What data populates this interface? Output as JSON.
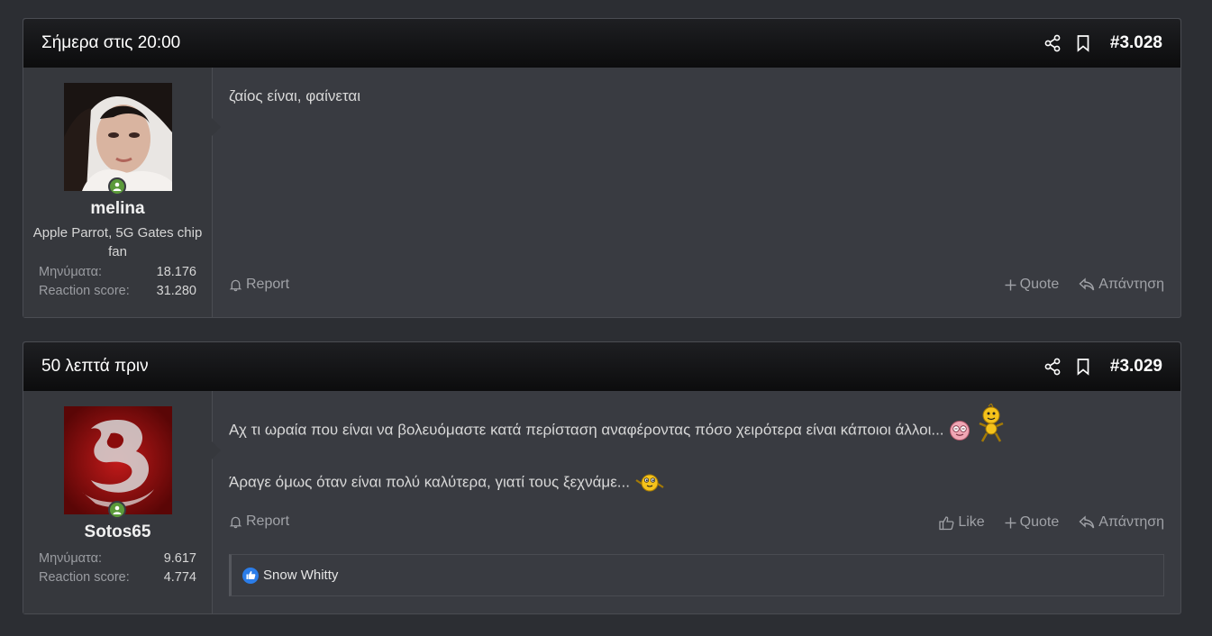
{
  "posts": [
    {
      "date": "Σήμερα στις 20:00",
      "number": "#3.028",
      "user": {
        "name": "melina",
        "title": "Apple Parrot, 5G Gates chip fan",
        "stats": [
          {
            "label": "Μηνύματα:",
            "value": "18.176"
          },
          {
            "label": "Reaction score:",
            "value": "31.280"
          }
        ]
      },
      "message": [
        "ζαίος είναι, φαίνεται"
      ],
      "actions": {
        "report": "Report",
        "quote": "Quote",
        "reply": "Απάντηση"
      }
    },
    {
      "date": "50 λεπτά πριν",
      "number": "#3.029",
      "user": {
        "name": "Sotos65",
        "stats": [
          {
            "label": "Μηνύματα:",
            "value": "9.617"
          },
          {
            "label": "Reaction score:",
            "value": "4.774"
          }
        ]
      },
      "message": [
        "Αχ τι ωραία που είναι να βολευόμαστε κατά περίσταση αναφέροντας πόσο χειρότερα είναι κάποιοι άλλοι...",
        "Άραγε όμως όταν είναι πολύ καλύτερα, γιατί τους ξεχνάμε..."
      ],
      "actions": {
        "report": "Report",
        "like": "Like",
        "quote": "Quote",
        "reply": "Απάντηση"
      },
      "reactions": {
        "users": "Snow Whitty"
      }
    }
  ],
  "icons": {
    "share": "share-icon",
    "bookmark": "bookmark-icon",
    "report": "bell-icon",
    "quote": "plus-icon",
    "reply": "reply-icon",
    "like": "thumbs-up-icon"
  }
}
